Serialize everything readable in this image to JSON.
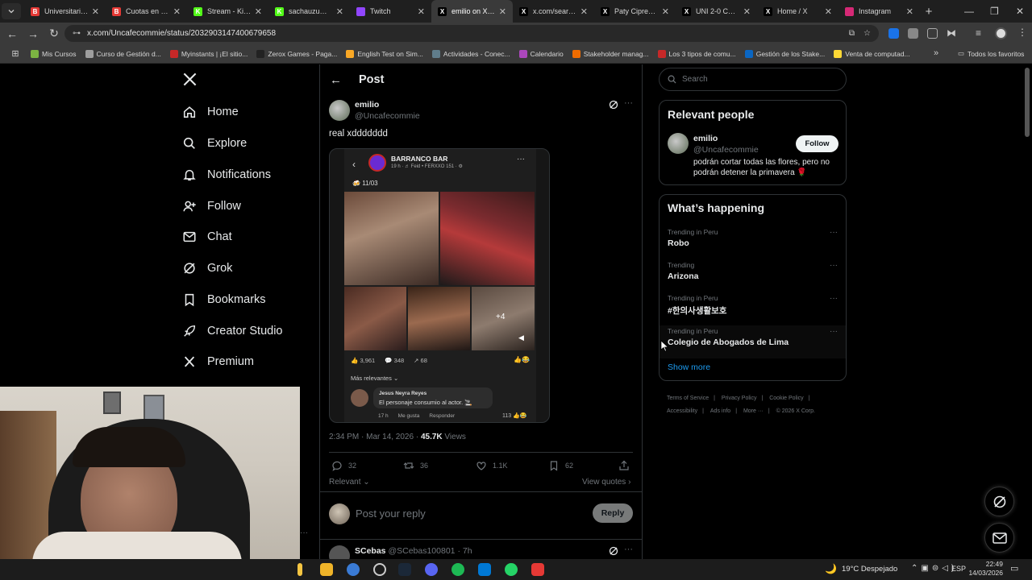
{
  "browser": {
    "tabs": [
      {
        "title": "Universitario d",
        "color": "#e53935",
        "letter": "B"
      },
      {
        "title": "Cuotas en Vivo",
        "color": "#e53935",
        "letter": "B"
      },
      {
        "title": "Stream - Kick D",
        "color": "#53fc18",
        "letter": "K"
      },
      {
        "title": "sachauzumaki",
        "color": "#53fc18",
        "letter": "K"
      },
      {
        "title": "Twitch",
        "color": "#9146ff",
        "letter": ""
      },
      {
        "title": "emilio on X: \"r",
        "color": "#000000",
        "letter": "X",
        "active": true
      },
      {
        "title": "x.com/search?c",
        "color": "#000000",
        "letter": "X"
      },
      {
        "title": "Paty Cipres🖤",
        "color": "#000000",
        "letter": "X"
      },
      {
        "title": "UNI 2-0 CAJ | U",
        "color": "#000000",
        "letter": "X"
      },
      {
        "title": "Home / X",
        "color": "#000000",
        "letter": "X"
      },
      {
        "title": "Instagram",
        "color": "#d62976",
        "letter": ""
      }
    ],
    "url": "x.com/Uncafecommie/status/2032903147400679658",
    "bookmarks": [
      {
        "label": "Mis Cursos",
        "color": "#7cb342"
      },
      {
        "label": "Curso de Gestión d...",
        "color": "#9e9e9e"
      },
      {
        "label": "Myinstants | ¡El sitio...",
        "color": "#c62828"
      },
      {
        "label": "Zerox Games - Paga...",
        "color": "#222222"
      },
      {
        "label": "English Test on Sim...",
        "color": "#f9a825"
      },
      {
        "label": "Actividades - Conec...",
        "color": "#607d8b"
      },
      {
        "label": "Calendario",
        "color": "#ab47bc"
      },
      {
        "label": "Stakeholder manag...",
        "color": "#ef6c00"
      },
      {
        "label": "Los 3 tipos de comu...",
        "color": "#c62828"
      },
      {
        "label": "Gestión de los Stake...",
        "color": "#0a66c2"
      },
      {
        "label": "Venta de computad...",
        "color": "#fdd835"
      }
    ],
    "all_bookmarks": "Todos los favoritos"
  },
  "nav": {
    "items": [
      {
        "label": "Home",
        "icon": "home-icon"
      },
      {
        "label": "Explore",
        "icon": "search-icon"
      },
      {
        "label": "Notifications",
        "icon": "bell-icon"
      },
      {
        "label": "Follow",
        "icon": "person-plus-icon"
      },
      {
        "label": "Chat",
        "icon": "mail-icon"
      },
      {
        "label": "Grok",
        "icon": "grok-icon"
      },
      {
        "label": "Bookmarks",
        "icon": "bookmark-icon"
      },
      {
        "label": "Creator Studio",
        "icon": "rocket-icon"
      },
      {
        "label": "Premium",
        "icon": "x-logo-icon"
      }
    ]
  },
  "post": {
    "header_title": "Post",
    "author_name": "emilio",
    "author_handle": "@Uncafecommie",
    "text": "real xddddddd",
    "time": "2:34 PM · Mar 14, 2026 · ",
    "views_count": "45.7K",
    "views_label": " Views",
    "replies": "32",
    "reposts": "36",
    "likes": "1.1K",
    "bookmarks": "62",
    "sort_label": "Relevant",
    "view_quotes": "View quotes",
    "reply_placeholder": "Post your reply",
    "reply_button": "Reply"
  },
  "embed": {
    "page_name": "BARRANCO BAR",
    "page_meta": "19 h · ♬ Feid • FERXXO 151 · ⚙",
    "date_tag": "11/03",
    "photo_extra": "+4",
    "likes": "3,961",
    "comments": "348",
    "shares": "68",
    "sort": "Más relevantes",
    "comment_author": "Jesus Neyra Reyes",
    "comment_text": "El personaje consumio al actor. 🚬",
    "comment_time": "17 h",
    "comment_like": "Me gusta",
    "comment_reply": "Responder",
    "comment_reactions": "113"
  },
  "next_reply": {
    "name": "SCebas",
    "handle": "@SCebas100801",
    "time": "· 7h"
  },
  "search": {
    "placeholder": "Search"
  },
  "relevant_people": {
    "title": "Relevant people",
    "name": "emilio",
    "handle": "@Uncafecommie",
    "follow_label": "Follow",
    "bio": "podrán cortar todas las flores, pero no podrán detener la primavera 🌹"
  },
  "happening": {
    "title": "What’s happening",
    "trends": [
      {
        "context": "Trending in Peru",
        "name": "Robo"
      },
      {
        "context": "Trending",
        "name": "Arizona"
      },
      {
        "context": "Trending in Peru",
        "name": "#한의사생활보호"
      },
      {
        "context": "Trending in Peru",
        "name": "Colegio de Abogados de Lima"
      }
    ],
    "show_more": "Show more"
  },
  "footer": {
    "links": [
      "Terms of Service",
      "Privacy Policy",
      "Cookie Policy",
      "Accessibility",
      "Ads info",
      "More ···",
      "© 2026 X Corp."
    ]
  },
  "taskbar": {
    "weather": "19°C  Despejado",
    "lang": "ESP",
    "time": "22:49",
    "date": "14/03/2026"
  },
  "colors": {
    "accent": "#1d9bf0",
    "background": "#000000",
    "border": "#2f3336",
    "muted": "#71767b"
  }
}
